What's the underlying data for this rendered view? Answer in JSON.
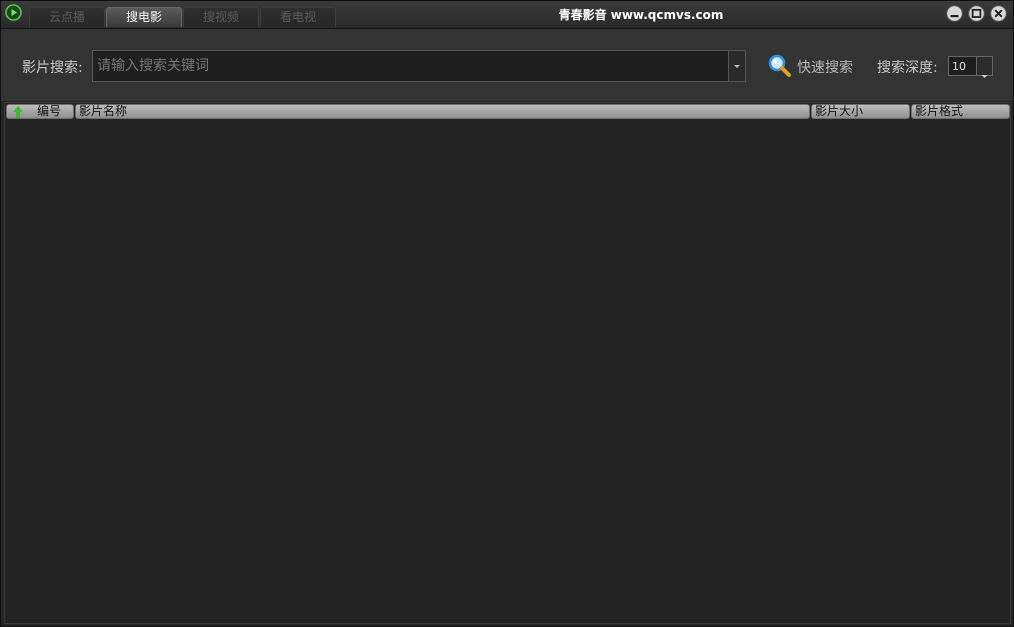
{
  "window": {
    "title": "青春影音 www.qcmvs.com"
  },
  "tabs": [
    {
      "label": "云点播",
      "active": false
    },
    {
      "label": "搜电影",
      "active": true
    },
    {
      "label": "搜视频",
      "active": false
    },
    {
      "label": "看电视",
      "active": false
    }
  ],
  "search": {
    "label": "影片搜索:",
    "placeholder": "请输入搜索关键词",
    "value": "",
    "quick_search_label": "快速搜索",
    "depth_label": "搜索深度:",
    "depth_value": "10"
  },
  "table": {
    "columns": [
      "编号",
      "影片名称",
      "影片大小",
      "影片格式"
    ],
    "rows": []
  },
  "icons": {
    "app_logo": "play-icon",
    "quick_search": "magnifier-icon",
    "sort": "sort-arrow-icon",
    "minimize": "minimize-icon",
    "maximize": "maximize-icon",
    "close": "close-icon"
  },
  "colors": {
    "accent_green": "#55c24a",
    "magnifier_blue": "#2f8fd8"
  }
}
